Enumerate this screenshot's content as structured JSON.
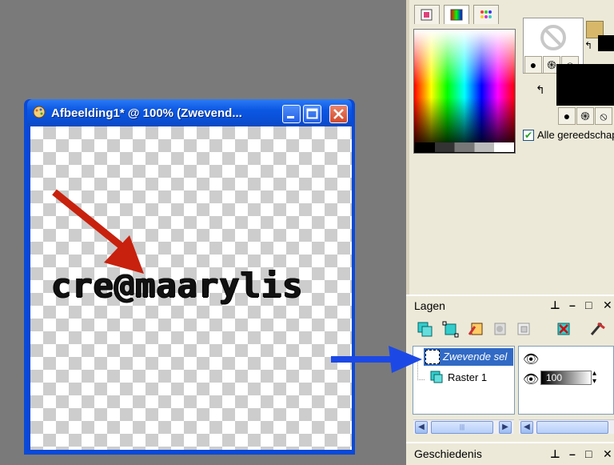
{
  "document": {
    "title": "Afbeelding1* @ 100% (Zwevend...",
    "canvas_text": "cre@maarylis"
  },
  "materials": {
    "tabs": [
      "frame-tab-icon",
      "rainbow-tab-icon",
      "swatches-tab-icon"
    ],
    "checkbox_label": "Alle gereedschapp",
    "checkbox_checked": true,
    "fg_swatch_color": "#d7b86a",
    "bg_swatch_color": "#000000"
  },
  "layers": {
    "title": "Lagen",
    "controls": {
      "pin": "⊥",
      "minimize": "–",
      "maximize": "□",
      "close": "✕"
    },
    "items": [
      {
        "label": "Zwevende sel",
        "selected": true
      },
      {
        "label": "Raster 1",
        "selected": false
      }
    ],
    "opacity": "100"
  },
  "history": {
    "title": "Geschiedenis"
  },
  "colors": {
    "arrow_red": "#c8210d",
    "arrow_blue": "#1c49e6",
    "titlebar_blue": "#0a4fd6"
  }
}
